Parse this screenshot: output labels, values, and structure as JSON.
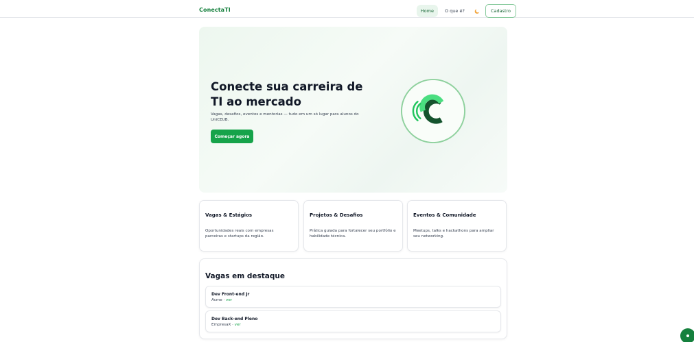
{
  "header": {
    "brand": "ConectaTI",
    "nav": [
      "Home",
      "O que é?"
    ],
    "cta": "Cadastro",
    "theme_icon": "moon-icon"
  },
  "hero": {
    "title": "Conecte sua carreira de TI ao mercado",
    "subtitle": "Vagas, desafios, eventos e mentorias — tudo em um só lugar para alunos do UniCEUB.",
    "button": "Começar agora",
    "logo_icon": "conectati-logo-icon"
  },
  "features": [
    {
      "title": "Vagas & Estágios",
      "desc": "Oportunidades reais com empresas parceiras e startups da região."
    },
    {
      "title": "Projetos & Desafios",
      "desc": "Prática guiada para fortalecer seu portfólio e habilidade técnica."
    },
    {
      "title": "Eventos & Comunidade",
      "desc": "Meetups, talks e hackathons para ampliar seu networking."
    }
  ],
  "jobs": {
    "title": "Vagas em destaque",
    "link_label": "ver",
    "separator": " · ",
    "items": [
      {
        "title": "Dev Front-end Jr",
        "company": "Acme"
      },
      {
        "title": "Dev Back-end Pleno",
        "company": "EmpresaX"
      }
    ]
  },
  "colors": {
    "accent": "#16a34a",
    "brand": "#15803d",
    "hero_bg": "#edf7ef"
  },
  "fab_icon": "chat-icon"
}
